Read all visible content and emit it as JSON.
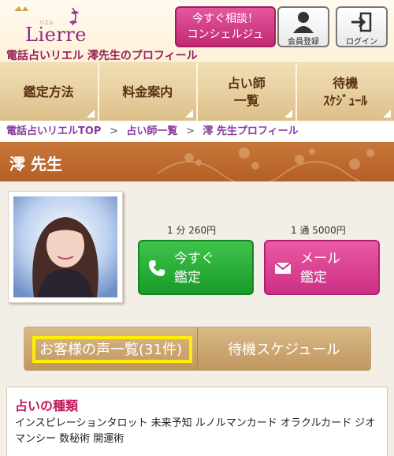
{
  "header": {
    "logo_text": "Lierre",
    "logo_sub": "リエル",
    "site_title": "電話占いリエル 澪先生のプロフィール",
    "consult_button": [
      "今すぐ相談！",
      "コンシェルジュ"
    ],
    "register_label": "会員登録",
    "login_label": "ログイン"
  },
  "nav": {
    "items": [
      {
        "lines": [
          "鑑定方法"
        ]
      },
      {
        "lines": [
          "料金案内"
        ]
      },
      {
        "lines": [
          "占い師",
          "一覧"
        ]
      },
      {
        "lines": [
          "待機",
          "ｽｹｼﾞｭｰﾙ"
        ]
      }
    ]
  },
  "breadcrumb": {
    "items": [
      "電話占いリエルTOP",
      "占い師一覧",
      "澪 先生プロフィール"
    ],
    "separator": ">"
  },
  "profile": {
    "name": "澪 先生",
    "call_price": "1 分 260円",
    "mail_price": "1 通 5000円",
    "call_button": [
      "今すぐ",
      "鑑定"
    ],
    "mail_button": [
      "メール",
      "鑑定"
    ]
  },
  "tabs": {
    "reviews": "お客様の声一覧(31件)",
    "schedule": "待機スケジュール"
  },
  "types": {
    "title": "占いの種類",
    "text": "インスピレーションタロット 未来予知 ルノルマンカード オラクルカード ジオマンシー 数秘術 開運術"
  },
  "colors": {
    "accent_pink": "#c22a74",
    "call_green": "#1a9b2a",
    "nav_brown": "#5a3216",
    "name_bar": "#b35e25",
    "highlight": "#ffee00"
  }
}
